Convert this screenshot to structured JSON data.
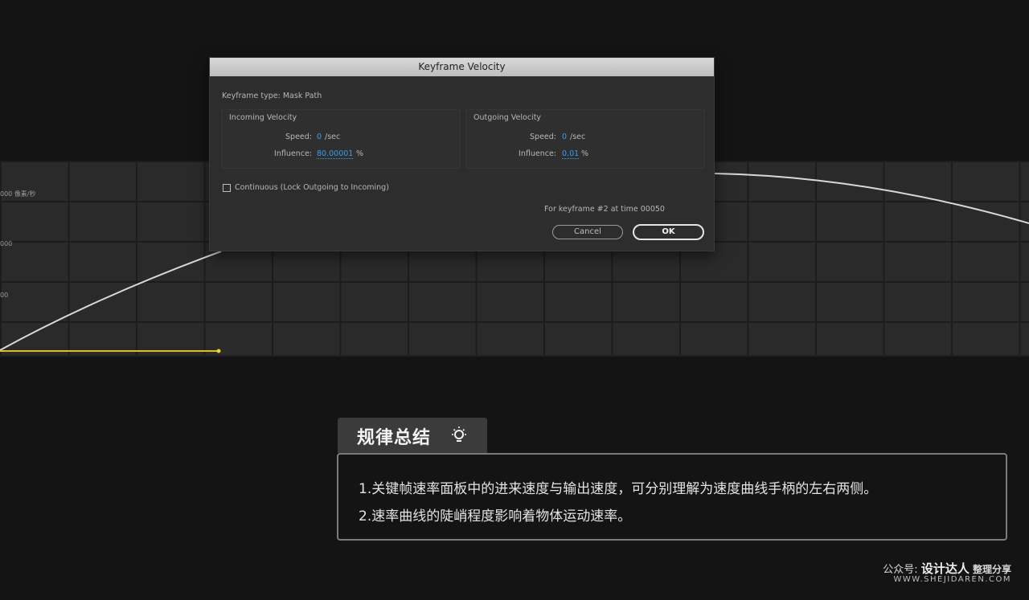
{
  "graph": {
    "axis_labels": [
      "000 像素/秒",
      "000",
      "00"
    ]
  },
  "dialog": {
    "title": "Keyframe Velocity",
    "keyframe_type": "Keyframe type: Mask Path",
    "incoming": {
      "heading": "Incoming Velocity",
      "speed_label": "Speed:",
      "speed_value": "0",
      "speed_unit": "/sec",
      "influence_label": "Influence:",
      "influence_value": "80.00001",
      "influence_unit": "%"
    },
    "outgoing": {
      "heading": "Outgoing Velocity",
      "speed_label": "Speed:",
      "speed_value": "0",
      "speed_unit": "/sec",
      "influence_label": "Influence:",
      "influence_value": "0.01",
      "influence_unit": "%"
    },
    "continuous_label": "Continuous (Lock Outgoing to Incoming)",
    "keyframe_info": "For keyframe #2 at time 00050",
    "cancel_label": "Cancel",
    "ok_label": "OK"
  },
  "summary": {
    "title": "规律总结",
    "icon": "lightbulb-icon",
    "lines": [
      "1.关键帧速率面板中的进来速度与输出速度，可分别理解为速度曲线手柄的左右两侧。",
      "2.速率曲线的陡峭程度影响着物体运动速率。"
    ]
  },
  "watermark": {
    "prefix": "公众号:",
    "brand": "设计达人",
    "suffix": "整理分享",
    "url": "WWW.SHEJIDAREN.COM"
  },
  "colors": {
    "accent_blue": "#3d9cf0",
    "keyframe_yellow": "#d9c21f",
    "curve": "#d8d8d8"
  }
}
